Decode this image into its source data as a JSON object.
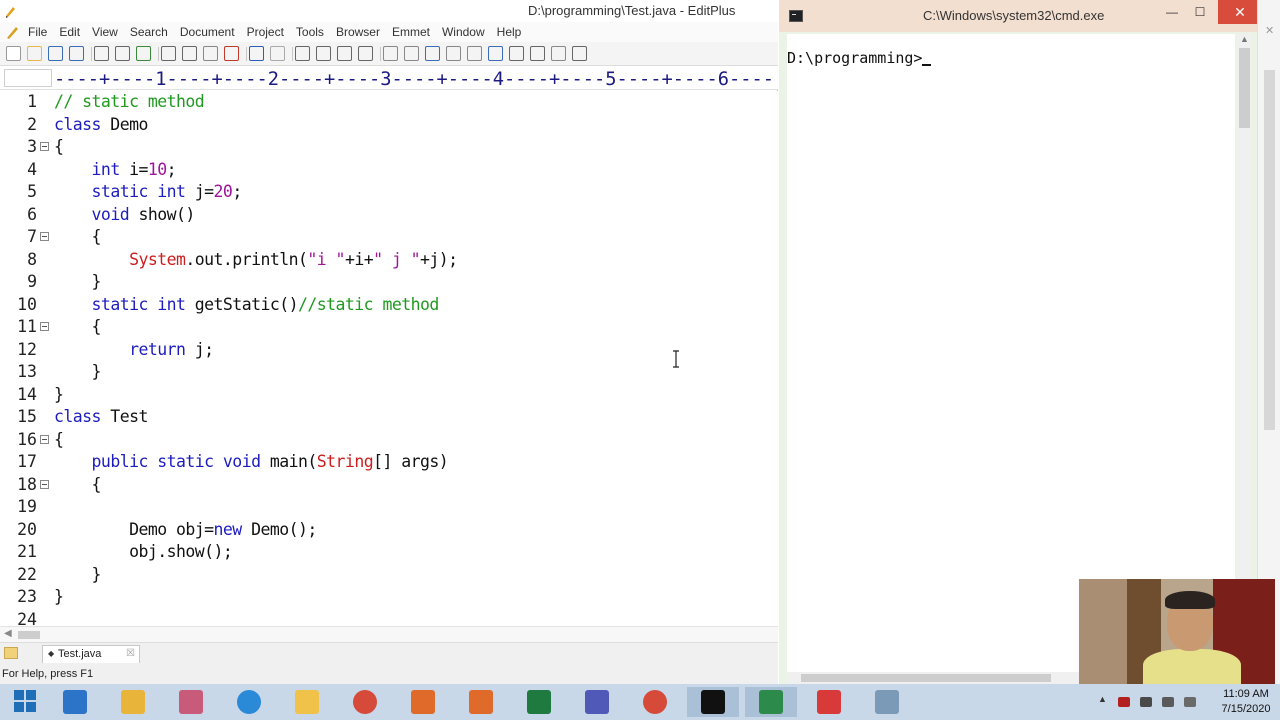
{
  "editplus": {
    "title": "D:\\programming\\Test.java - EditPlus",
    "menu": [
      "File",
      "Edit",
      "View",
      "Search",
      "Document",
      "Project",
      "Tools",
      "Browser",
      "Emmet",
      "Window",
      "Help"
    ],
    "ruler": "----+----1----+----2----+----3----+----4----+----5----+----6----",
    "lines": [
      {
        "n": "1",
        "fold": false,
        "tokens": [
          {
            "t": "// static method",
            "c": "com"
          }
        ]
      },
      {
        "n": "2",
        "fold": false,
        "tokens": [
          {
            "t": "class",
            "c": "kw"
          },
          {
            "t": " Demo",
            "c": "txt"
          }
        ]
      },
      {
        "n": "3",
        "fold": true,
        "tokens": [
          {
            "t": "{",
            "c": "txt"
          }
        ]
      },
      {
        "n": "4",
        "fold": false,
        "tokens": [
          {
            "t": "    ",
            "c": "txt"
          },
          {
            "t": "int",
            "c": "kw"
          },
          {
            "t": " i=",
            "c": "txt"
          },
          {
            "t": "10",
            "c": "num"
          },
          {
            "t": ";",
            "c": "txt"
          }
        ]
      },
      {
        "n": "5",
        "fold": false,
        "tokens": [
          {
            "t": "    ",
            "c": "txt"
          },
          {
            "t": "static int",
            "c": "kw"
          },
          {
            "t": " j=",
            "c": "txt"
          },
          {
            "t": "20",
            "c": "num"
          },
          {
            "t": ";",
            "c": "txt"
          }
        ]
      },
      {
        "n": "6",
        "fold": false,
        "tokens": [
          {
            "t": "    ",
            "c": "txt"
          },
          {
            "t": "void",
            "c": "kw"
          },
          {
            "t": " show()",
            "c": "txt"
          }
        ]
      },
      {
        "n": "7",
        "fold": true,
        "tokens": [
          {
            "t": "    {",
            "c": "txt"
          }
        ]
      },
      {
        "n": "8",
        "fold": false,
        "tokens": [
          {
            "t": "        ",
            "c": "txt"
          },
          {
            "t": "System",
            "c": "cls"
          },
          {
            "t": ".out.println(",
            "c": "txt"
          },
          {
            "t": "\"i \"",
            "c": "str"
          },
          {
            "t": "+i+",
            "c": "txt"
          },
          {
            "t": "\" j \"",
            "c": "str"
          },
          {
            "t": "+j);",
            "c": "txt"
          }
        ]
      },
      {
        "n": "9",
        "fold": false,
        "tokens": [
          {
            "t": "    }",
            "c": "txt"
          }
        ]
      },
      {
        "n": "10",
        "fold": false,
        "tokens": [
          {
            "t": "    ",
            "c": "txt"
          },
          {
            "t": "static int",
            "c": "kw"
          },
          {
            "t": " getStatic()",
            "c": "txt"
          },
          {
            "t": "//static method",
            "c": "com"
          }
        ]
      },
      {
        "n": "11",
        "fold": true,
        "tokens": [
          {
            "t": "    {",
            "c": "txt"
          }
        ]
      },
      {
        "n": "12",
        "fold": false,
        "tokens": [
          {
            "t": "        ",
            "c": "txt"
          },
          {
            "t": "return",
            "c": "kw"
          },
          {
            "t": " j;",
            "c": "txt"
          }
        ]
      },
      {
        "n": "13",
        "fold": false,
        "tokens": [
          {
            "t": "    }",
            "c": "txt"
          }
        ]
      },
      {
        "n": "14",
        "fold": false,
        "tokens": [
          {
            "t": "}",
            "c": "txt"
          }
        ]
      },
      {
        "n": "15",
        "fold": false,
        "tokens": [
          {
            "t": "class",
            "c": "kw"
          },
          {
            "t": " Test",
            "c": "txt"
          }
        ]
      },
      {
        "n": "16",
        "fold": true,
        "tokens": [
          {
            "t": "{",
            "c": "txt"
          }
        ]
      },
      {
        "n": "17",
        "fold": false,
        "tokens": [
          {
            "t": "    ",
            "c": "txt"
          },
          {
            "t": "public static void",
            "c": "kw"
          },
          {
            "t": " main(",
            "c": "txt"
          },
          {
            "t": "String",
            "c": "cls"
          },
          {
            "t": "[] args)",
            "c": "txt"
          }
        ]
      },
      {
        "n": "18",
        "fold": true,
        "tokens": [
          {
            "t": "    {",
            "c": "txt"
          }
        ]
      },
      {
        "n": "19",
        "fold": false,
        "tokens": []
      },
      {
        "n": "20",
        "fold": false,
        "tokens": [
          {
            "t": "        Demo obj=",
            "c": "txt"
          },
          {
            "t": "new",
            "c": "kw"
          },
          {
            "t": " Demo();",
            "c": "txt"
          }
        ]
      },
      {
        "n": "21",
        "fold": false,
        "tokens": [
          {
            "t": "        obj.show();",
            "c": "txt"
          }
        ]
      },
      {
        "n": "22",
        "fold": false,
        "tokens": [
          {
            "t": "    }",
            "c": "txt"
          }
        ]
      },
      {
        "n": "23",
        "fold": false,
        "tokens": [
          {
            "t": "}",
            "c": "txt"
          }
        ]
      },
      {
        "n": "24",
        "fold": false,
        "tokens": []
      }
    ],
    "tab_label": "Test.java",
    "tab_close": "☒",
    "status": "For Help, press F1"
  },
  "cmd": {
    "title": "C:\\Windows\\system32\\cmd.exe",
    "prompt": "D:\\programming>",
    "min": "—",
    "max": "☐",
    "close": "✕"
  },
  "taskbar": {
    "apps": [
      "start-icon",
      "calculator-icon",
      "file-explorer-icon",
      "paint-icon",
      "internet-explorer-icon",
      "folder-icon",
      "chrome-icon",
      "camtasia-recorder-icon",
      "camtasia-studio-icon",
      "excel-icon",
      "teams-icon",
      "chrome-profile-icon",
      "cmd-icon",
      "editplus-icon",
      "eraser-app-icon",
      "paint-palette-icon"
    ],
    "time": "11:09 AM",
    "date": "7/15/2020"
  },
  "colors": {
    "keyword": "#1d1dbf",
    "number_string": "#a0149a",
    "class": "#cc1e1e",
    "comment": "#1f9a1f",
    "cmd_titlebar": "#f3dfd0",
    "close_red": "#d84c3c"
  }
}
